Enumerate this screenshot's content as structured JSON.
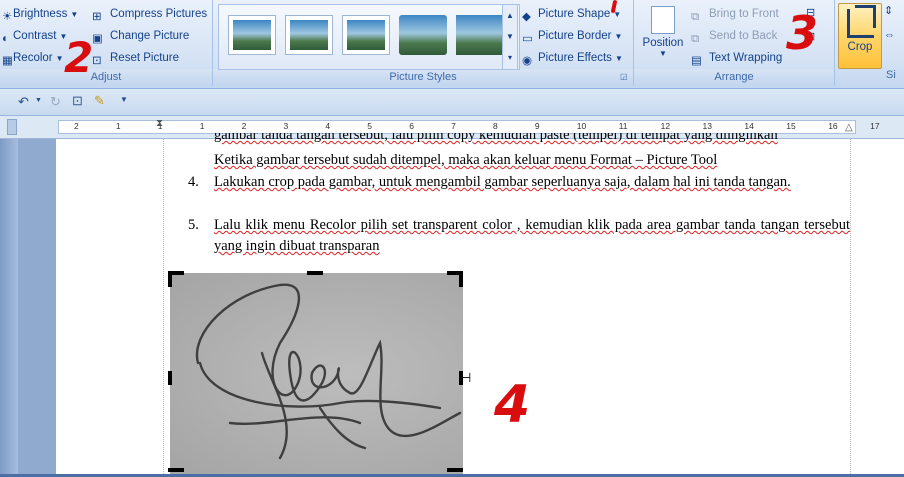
{
  "ribbon": {
    "adjust": {
      "brightness": "Brightness",
      "contrast": "Contrast",
      "recolor": "Recolor",
      "compress": "Compress Pictures",
      "change": "Change Picture",
      "reset": "Reset Picture",
      "label": "Adjust"
    },
    "styles": {
      "shape": "Picture Shape",
      "border": "Picture Border",
      "effects": "Picture Effects",
      "label": "Picture Styles"
    },
    "arrange": {
      "position": "Position",
      "front": "Bring to Front",
      "back": "Send to Back",
      "wrap": "Text Wrapping",
      "label": "Arrange"
    },
    "size": {
      "crop": "Crop",
      "label": "Si"
    }
  },
  "ruler": [
    "2",
    "1",
    "1",
    "1",
    "2",
    "3",
    "4",
    "5",
    "6",
    "7",
    "8",
    "9",
    "10",
    "11",
    "12",
    "13",
    "14",
    "15",
    "16",
    "17"
  ],
  "doc": {
    "line0": "gambar tanda tangan tersebut, lalu pilih copy kemudian paste (tempel) di tempat yang diinginkan",
    "line1": "Ketika gambar tersebut sudah ditempel, maka akan keluar menu Format – Picture Tool",
    "item4num": "4.",
    "item4": "Lakukan crop pada gambar, untuk mengambil gambar seperluanya saja, dalam hal ini tanda tangan.",
    "item5num": "5.",
    "item5": "Lalu klik menu Recolor pilih set transparent color , kemudian klik pada area gambar tanda tangan tersebut yang ingin dibuat transparan"
  },
  "annotations": {
    "a2": "2",
    "a3": "3",
    "a4": "4"
  },
  "colors": {
    "accent": "#d90d0d",
    "ribbon": "#d4e2f4"
  }
}
